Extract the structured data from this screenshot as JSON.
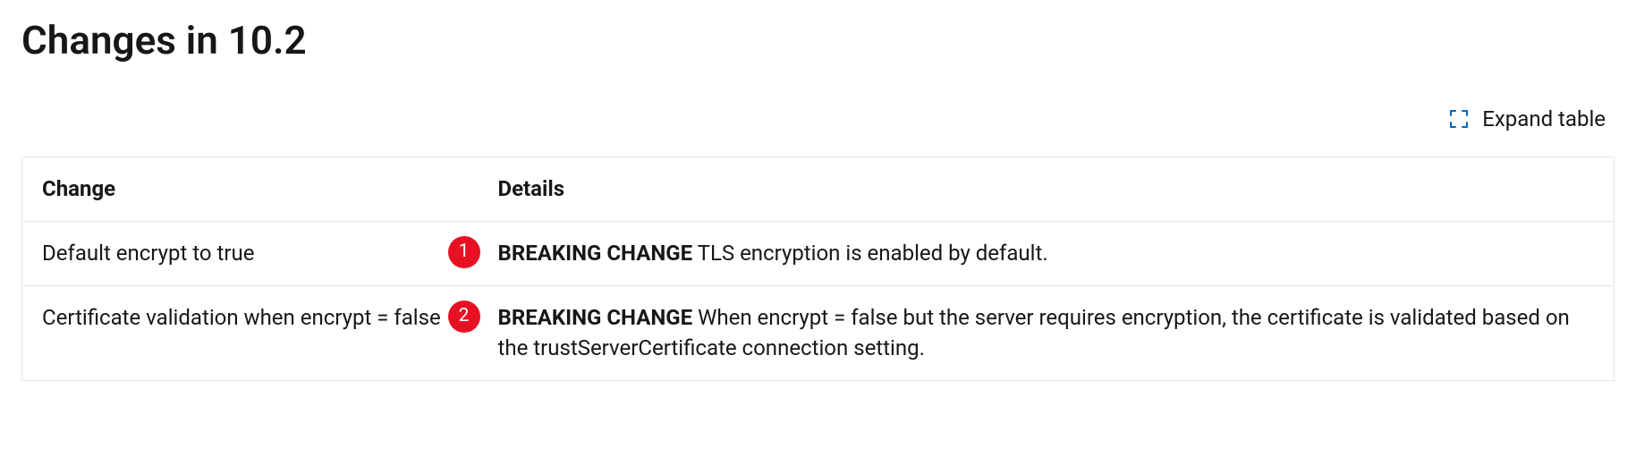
{
  "heading": "Changes in 10.2",
  "toolbar": {
    "expand_label": "Expand table"
  },
  "table": {
    "columns": {
      "change": "Change",
      "details": "Details"
    },
    "rows": [
      {
        "annotation": "1",
        "change": "Default encrypt to true",
        "details_strong": "BREAKING CHANGE",
        "details_rest": " TLS encryption is enabled by default."
      },
      {
        "annotation": "2",
        "change": "Certificate validation when encrypt = false",
        "details_strong": "BREAKING CHANGE",
        "details_rest": " When encrypt = false but the server requires encryption, the certificate is validated based on the trustServerCertificate connection setting."
      }
    ]
  }
}
